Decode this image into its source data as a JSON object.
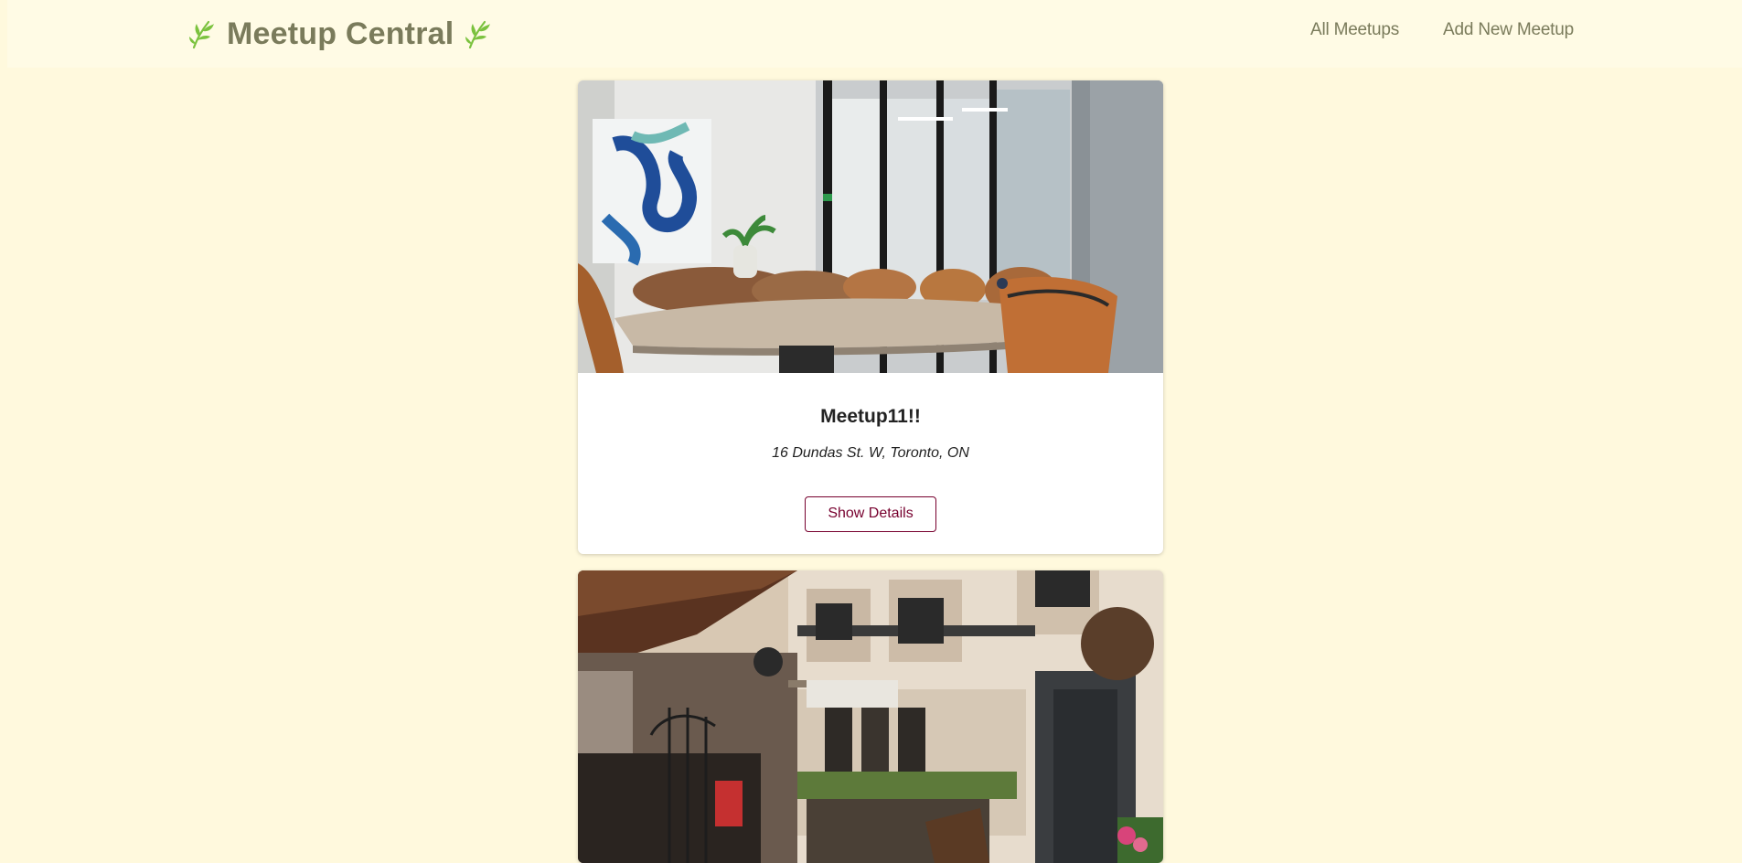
{
  "header": {
    "brand_title": "Meetup Central",
    "left_icon": "leaf-icon",
    "right_icon": "leaf-icon",
    "nav": [
      {
        "label": "All Meetups"
      },
      {
        "label": "Add New Meetup"
      }
    ]
  },
  "meetups": [
    {
      "image": "conference-room-photo",
      "title": "Meetup11!!",
      "address": "16 Dundas St. W, Toronto, ON",
      "button_label": "Show Details"
    },
    {
      "image": "street-cafe-photo"
    }
  ],
  "colors": {
    "page_background": "#fff9dd",
    "header_background": "#fffbe5",
    "brand_text": "#7a7b5b",
    "leaf_green": "#7bc23e",
    "button_accent": "#77002e"
  }
}
